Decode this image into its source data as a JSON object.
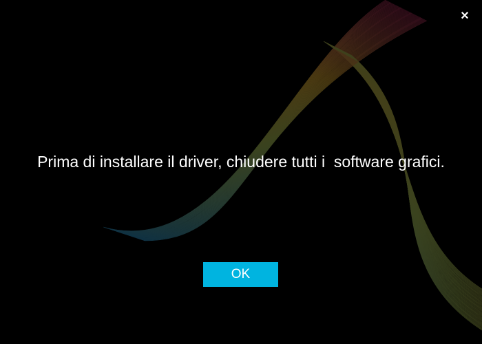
{
  "dialog": {
    "close_glyph": "×",
    "message": "Prima di installare il driver, chiudere tutti i  software grafici.",
    "ok_label": "OK"
  },
  "colors": {
    "background": "#000000",
    "button": "#00b4e0",
    "text": "#ffffff"
  }
}
